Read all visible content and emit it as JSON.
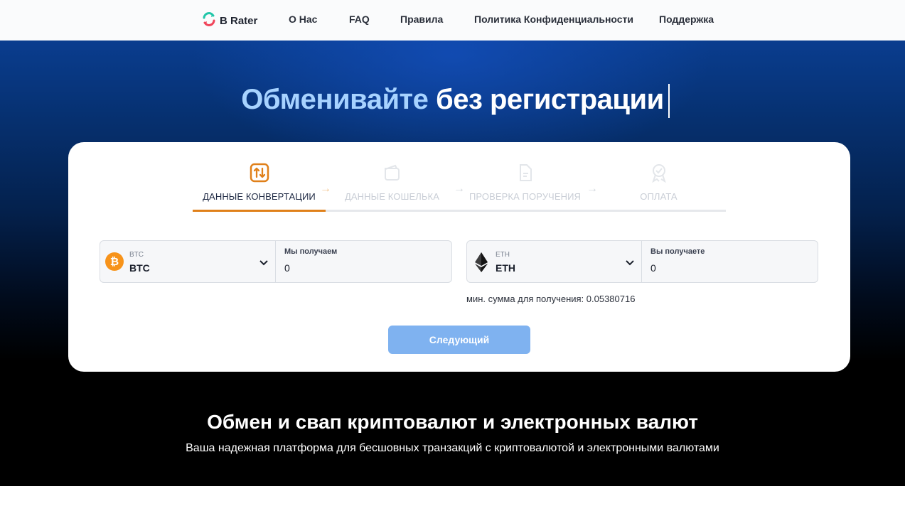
{
  "nav": {
    "brand": "B Rater",
    "links": [
      "О Нас",
      "FAQ",
      "Правила",
      "Политика Конфиденциальности",
      "Поддержка"
    ]
  },
  "hero": {
    "title_highlight": "Обменивайте",
    "title_rest": "без регистрации"
  },
  "steps": [
    {
      "label": "ДАННЫЕ КОНВЕРТАЦИИ",
      "icon": "swap-icon",
      "active": true
    },
    {
      "label": "ДАННЫЕ КОШЕЛЬКА",
      "icon": "wallet-icon",
      "active": false
    },
    {
      "label": "ПРОВЕРКА ПОРУЧЕНИЯ",
      "icon": "document-icon",
      "active": false
    },
    {
      "label": "ОПЛАТА",
      "icon": "badge-icon",
      "active": false
    }
  ],
  "send": {
    "coin_code": "BTC",
    "coin_name": "BTC",
    "amount_label": "Мы получаем",
    "amount_value": "0"
  },
  "receive": {
    "coin_code": "ETH",
    "coin_name": "ETH",
    "amount_label": "Вы получаете",
    "amount_value": "0"
  },
  "min_sum": "мин. сумма для получения: 0.05380716",
  "next_button": "Следующий",
  "section": {
    "title": "Обмен и свап криптовалют и электронных валют",
    "subtitle": "Ваша надежная платформа для бесшовных транзакций с криптовалютой и электронными валютами"
  },
  "colors": {
    "accent": "#e0801a",
    "button": "#7fb2f0",
    "highlight": "#a7d3ff",
    "btc": "#f7931a"
  }
}
